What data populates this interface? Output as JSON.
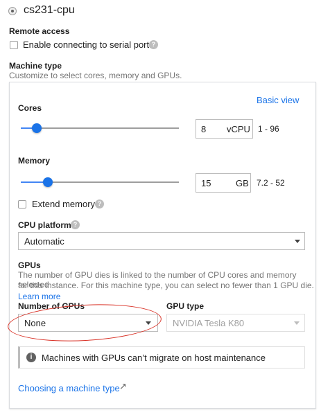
{
  "instance": {
    "name": "cs231-cpu"
  },
  "remote_access": {
    "title": "Remote access",
    "serial_label": "Enable connecting to serial ports"
  },
  "machine_type": {
    "title": "Machine type",
    "subtitle": "Customize to select cores, memory and GPUs.",
    "basic_view": "Basic view",
    "cores": {
      "label": "Cores",
      "value": "8",
      "unit": "vCPU",
      "range": "1 - 96",
      "slider_fraction": 0.1
    },
    "memory": {
      "label": "Memory",
      "value": "15",
      "unit": "GB",
      "range": "7.2 - 52",
      "slider_fraction": 0.17
    },
    "extend_memory_label": "Extend memory",
    "cpu_platform": {
      "label": "CPU platform",
      "value": "Automatic"
    },
    "gpus": {
      "title": "GPUs",
      "description_1": "The number of GPU dies is linked to the number of CPU cores and memory selected",
      "description_2": "for this instance. For this machine type, you can select no fewer than 1 GPU die.",
      "learn_more": "Learn more",
      "number_label": "Number of GPUs",
      "number_value": "None",
      "type_label": "GPU type",
      "type_value": "NVIDIA Tesla K80"
    },
    "notice": "Machines with GPUs can’t migrate on host maintenance",
    "choosing_link": "Choosing a machine type"
  },
  "icons": {
    "help": "?",
    "info": "i",
    "external": "↗"
  },
  "colors": {
    "accent": "#1a73e8",
    "annotation": "#d93025"
  }
}
